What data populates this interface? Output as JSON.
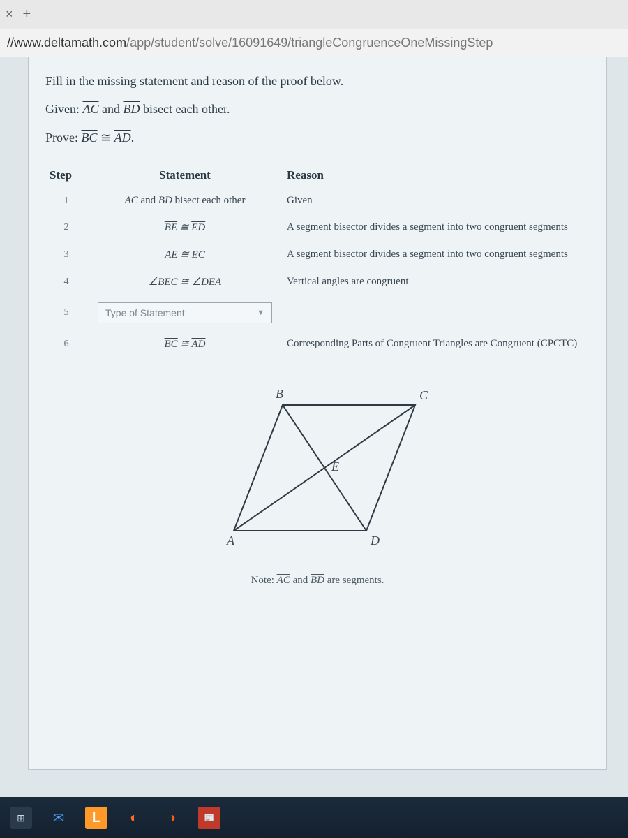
{
  "browser": {
    "close_glyph": "×",
    "plus_glyph": "+",
    "url_prefix": "//www.deltamath.com",
    "url_path": "/app/student/solve/16091649/triangleCongruenceOneMissingStep"
  },
  "prompt": {
    "instruction": "Fill in the missing statement and reason of the proof below.",
    "given_label": "Given:",
    "given_seg1": "AC",
    "given_and": " and ",
    "given_seg2": "BD",
    "given_tail": " bisect each other.",
    "prove_label": "Prove:",
    "prove_seg1": "BC",
    "prove_cong": " ≅ ",
    "prove_seg2": "AD",
    "prove_tail": "."
  },
  "headers": {
    "step": "Step",
    "statement": "Statement",
    "reason": "Reason"
  },
  "rows": [
    {
      "step": "1",
      "statement_html": "AC and BD bisect each other",
      "reason": "Given"
    },
    {
      "step": "2",
      "statement_html": "BE ≅ ED",
      "reason": "A segment bisector divides a segment into two congruent segments"
    },
    {
      "step": "3",
      "statement_html": "AE ≅ EC",
      "reason": "A segment bisector divides a segment into two congruent segments"
    },
    {
      "step": "4",
      "statement_html": "∠BEC ≅ ∠DEA",
      "reason": "Vertical angles are congruent"
    },
    {
      "step": "5",
      "statement_html": "",
      "reason": ""
    },
    {
      "step": "6",
      "statement_html": "BC ≅ AD",
      "reason": "Corresponding Parts of Congruent Triangles are Congruent (CPCTC)"
    }
  ],
  "dropdown": {
    "placeholder": "Type of Statement"
  },
  "figure": {
    "labels": {
      "A": "A",
      "B": "B",
      "C": "C",
      "D": "D",
      "E": "E"
    }
  },
  "note": {
    "prefix": "Note: ",
    "seg1": "AC",
    "and": " and ",
    "seg2": "BD",
    "tail": " are segments."
  },
  "taskbar": {
    "store": "⊞",
    "mail": "✉",
    "L": "L",
    "pp1": "◐",
    "pp2": "◑",
    "news": "📰"
  }
}
